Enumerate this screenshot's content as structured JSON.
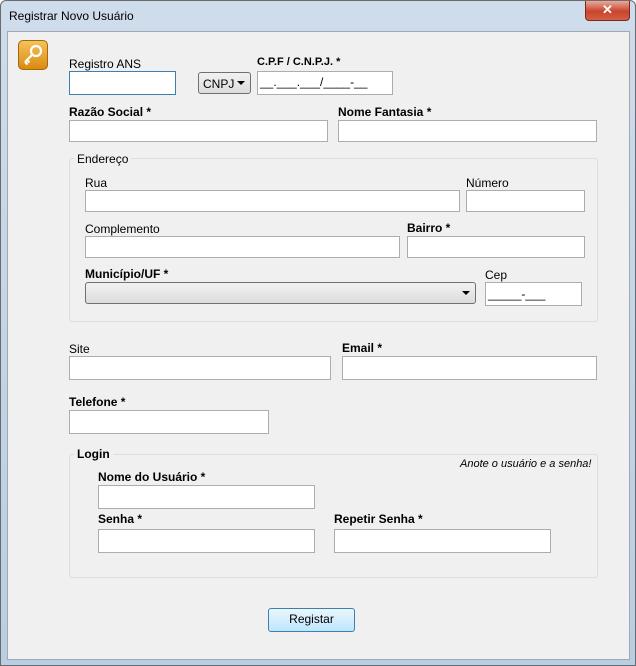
{
  "window": {
    "title": "Registrar Novo Usuário",
    "close_glyph": "✕"
  },
  "icons": {
    "app": "key-icon"
  },
  "labels": {
    "registro_ans": "Registro ANS",
    "cpf_cnpj": "C.P.F / C.N.P.J. *",
    "razao_social": "Razão Social *",
    "nome_fantasia": "Nome Fantasia *",
    "endereco_group": "Endereço",
    "rua": "Rua",
    "numero": "Número",
    "complemento": "Complemento",
    "bairro": "Bairro *",
    "municipio_uf": "Município/UF *",
    "cep": "Cep",
    "site": "Site",
    "email": "Email *",
    "telefone": "Telefone *",
    "login_group": "Login",
    "login_hint": "Anote o usuário e a senha!",
    "nome_usuario": "Nome do Usuário *",
    "senha": "Senha *",
    "repetir_senha": "Repetir Senha *"
  },
  "fields": {
    "doc_type_selected": "CNPJ",
    "cpf_cnpj_mask": "__.___.___/____-__",
    "cep_mask": "_____-___"
  },
  "buttons": {
    "registrar": "Registar"
  },
  "colors": {
    "focus_border": "#3c7fb1",
    "button_fill": "#bee6fd",
    "icon_orange": "#e39a1c"
  }
}
